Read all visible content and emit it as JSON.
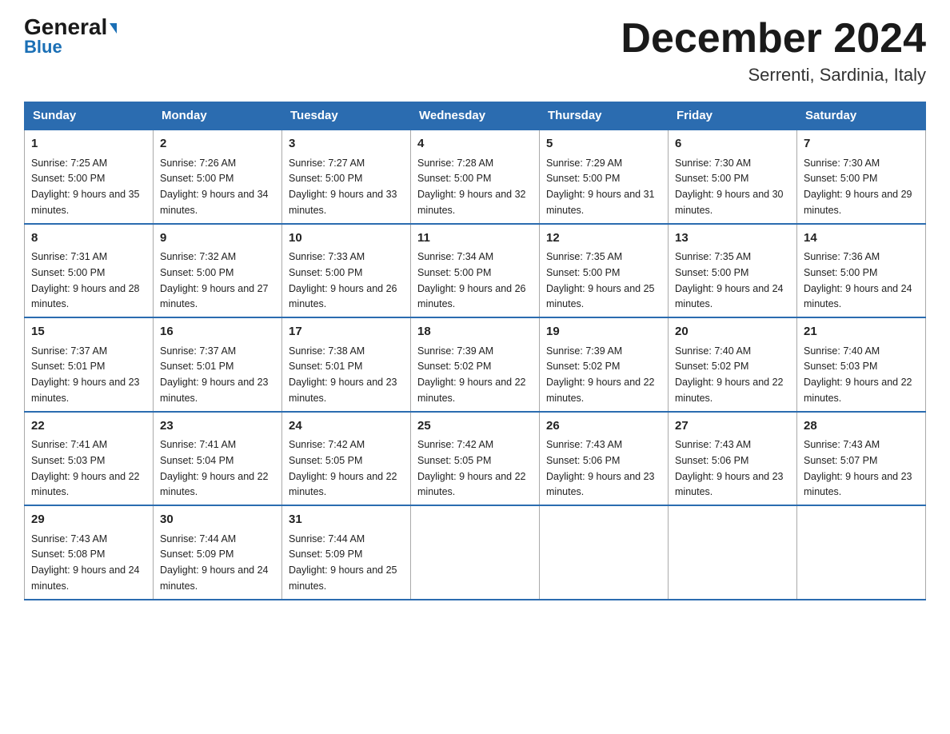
{
  "logo": {
    "general": "General",
    "blue": "Blue"
  },
  "title": "December 2024",
  "location": "Serrenti, Sardinia, Italy",
  "days_of_week": [
    "Sunday",
    "Monday",
    "Tuesday",
    "Wednesday",
    "Thursday",
    "Friday",
    "Saturday"
  ],
  "weeks": [
    [
      {
        "day": "1",
        "sunrise": "7:25 AM",
        "sunset": "5:00 PM",
        "daylight": "9 hours and 35 minutes."
      },
      {
        "day": "2",
        "sunrise": "7:26 AM",
        "sunset": "5:00 PM",
        "daylight": "9 hours and 34 minutes."
      },
      {
        "day": "3",
        "sunrise": "7:27 AM",
        "sunset": "5:00 PM",
        "daylight": "9 hours and 33 minutes."
      },
      {
        "day": "4",
        "sunrise": "7:28 AM",
        "sunset": "5:00 PM",
        "daylight": "9 hours and 32 minutes."
      },
      {
        "day": "5",
        "sunrise": "7:29 AM",
        "sunset": "5:00 PM",
        "daylight": "9 hours and 31 minutes."
      },
      {
        "day": "6",
        "sunrise": "7:30 AM",
        "sunset": "5:00 PM",
        "daylight": "9 hours and 30 minutes."
      },
      {
        "day": "7",
        "sunrise": "7:30 AM",
        "sunset": "5:00 PM",
        "daylight": "9 hours and 29 minutes."
      }
    ],
    [
      {
        "day": "8",
        "sunrise": "7:31 AM",
        "sunset": "5:00 PM",
        "daylight": "9 hours and 28 minutes."
      },
      {
        "day": "9",
        "sunrise": "7:32 AM",
        "sunset": "5:00 PM",
        "daylight": "9 hours and 27 minutes."
      },
      {
        "day": "10",
        "sunrise": "7:33 AM",
        "sunset": "5:00 PM",
        "daylight": "9 hours and 26 minutes."
      },
      {
        "day": "11",
        "sunrise": "7:34 AM",
        "sunset": "5:00 PM",
        "daylight": "9 hours and 26 minutes."
      },
      {
        "day": "12",
        "sunrise": "7:35 AM",
        "sunset": "5:00 PM",
        "daylight": "9 hours and 25 minutes."
      },
      {
        "day": "13",
        "sunrise": "7:35 AM",
        "sunset": "5:00 PM",
        "daylight": "9 hours and 24 minutes."
      },
      {
        "day": "14",
        "sunrise": "7:36 AM",
        "sunset": "5:00 PM",
        "daylight": "9 hours and 24 minutes."
      }
    ],
    [
      {
        "day": "15",
        "sunrise": "7:37 AM",
        "sunset": "5:01 PM",
        "daylight": "9 hours and 23 minutes."
      },
      {
        "day": "16",
        "sunrise": "7:37 AM",
        "sunset": "5:01 PM",
        "daylight": "9 hours and 23 minutes."
      },
      {
        "day": "17",
        "sunrise": "7:38 AM",
        "sunset": "5:01 PM",
        "daylight": "9 hours and 23 minutes."
      },
      {
        "day": "18",
        "sunrise": "7:39 AM",
        "sunset": "5:02 PM",
        "daylight": "9 hours and 22 minutes."
      },
      {
        "day": "19",
        "sunrise": "7:39 AM",
        "sunset": "5:02 PM",
        "daylight": "9 hours and 22 minutes."
      },
      {
        "day": "20",
        "sunrise": "7:40 AM",
        "sunset": "5:02 PM",
        "daylight": "9 hours and 22 minutes."
      },
      {
        "day": "21",
        "sunrise": "7:40 AM",
        "sunset": "5:03 PM",
        "daylight": "9 hours and 22 minutes."
      }
    ],
    [
      {
        "day": "22",
        "sunrise": "7:41 AM",
        "sunset": "5:03 PM",
        "daylight": "9 hours and 22 minutes."
      },
      {
        "day": "23",
        "sunrise": "7:41 AM",
        "sunset": "5:04 PM",
        "daylight": "9 hours and 22 minutes."
      },
      {
        "day": "24",
        "sunrise": "7:42 AM",
        "sunset": "5:05 PM",
        "daylight": "9 hours and 22 minutes."
      },
      {
        "day": "25",
        "sunrise": "7:42 AM",
        "sunset": "5:05 PM",
        "daylight": "9 hours and 22 minutes."
      },
      {
        "day": "26",
        "sunrise": "7:43 AM",
        "sunset": "5:06 PM",
        "daylight": "9 hours and 23 minutes."
      },
      {
        "day": "27",
        "sunrise": "7:43 AM",
        "sunset": "5:06 PM",
        "daylight": "9 hours and 23 minutes."
      },
      {
        "day": "28",
        "sunrise": "7:43 AM",
        "sunset": "5:07 PM",
        "daylight": "9 hours and 23 minutes."
      }
    ],
    [
      {
        "day": "29",
        "sunrise": "7:43 AM",
        "sunset": "5:08 PM",
        "daylight": "9 hours and 24 minutes."
      },
      {
        "day": "30",
        "sunrise": "7:44 AM",
        "sunset": "5:09 PM",
        "daylight": "9 hours and 24 minutes."
      },
      {
        "day": "31",
        "sunrise": "7:44 AM",
        "sunset": "5:09 PM",
        "daylight": "9 hours and 25 minutes."
      },
      null,
      null,
      null,
      null
    ]
  ]
}
